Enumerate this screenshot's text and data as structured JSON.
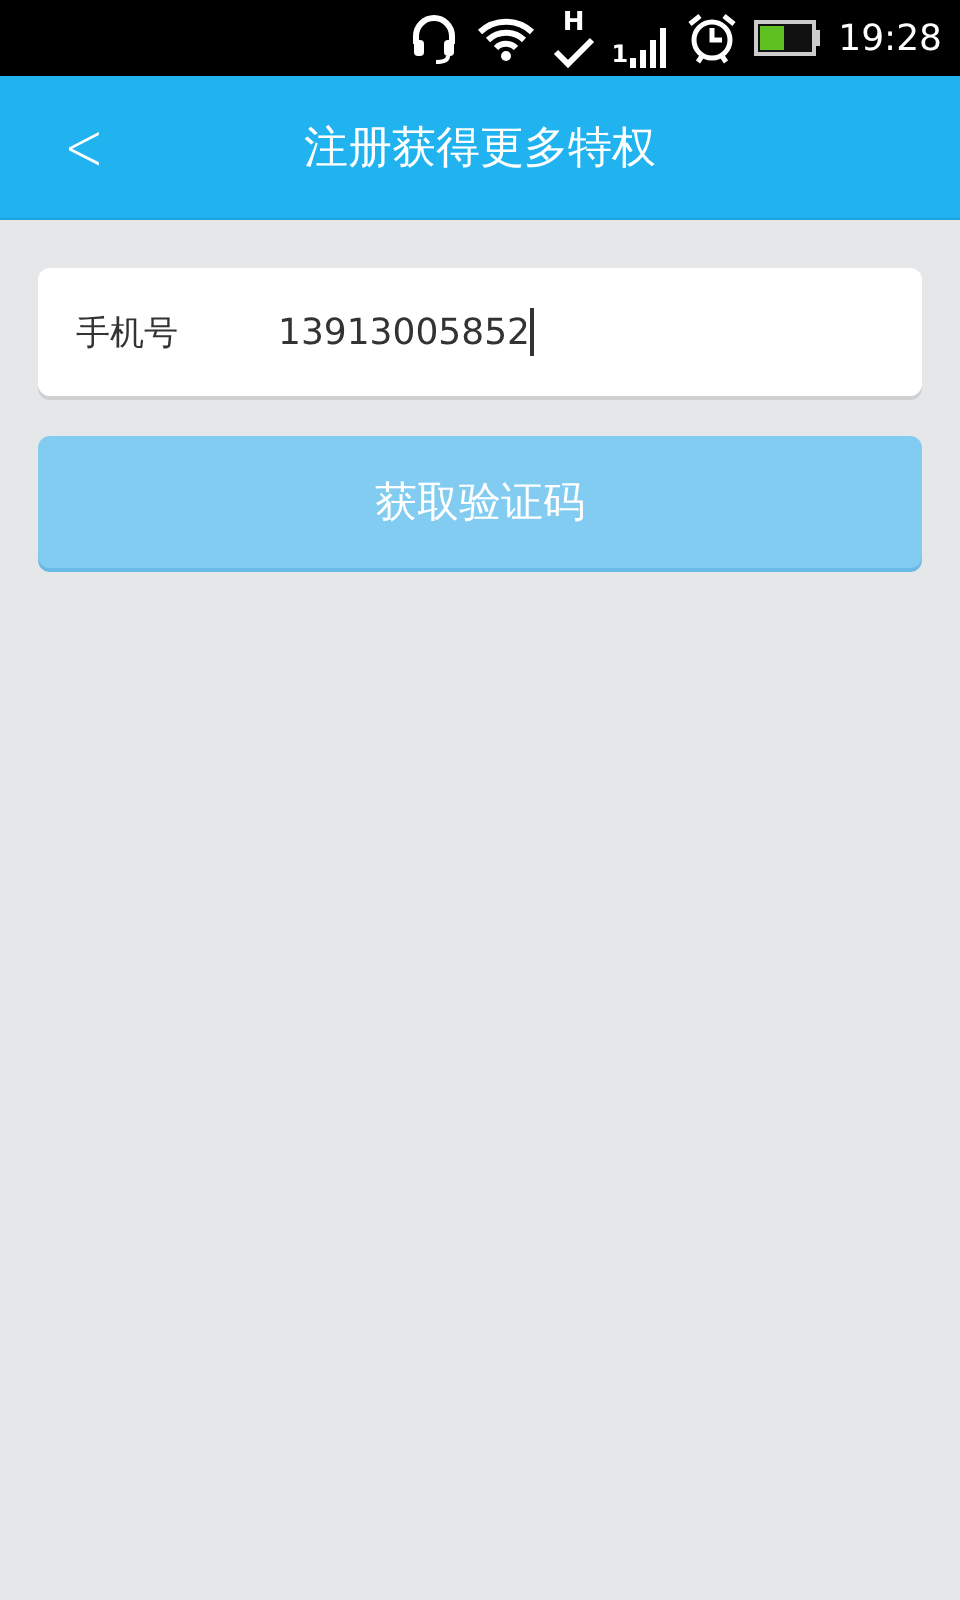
{
  "status_bar": {
    "network": "H",
    "sim": "1",
    "time": "19:28"
  },
  "header": {
    "back": "<",
    "title": "注册获得更多特权"
  },
  "phone_field": {
    "label": "手机号",
    "value": "13913005852",
    "focused": true
  },
  "button": {
    "label": "获取验证码",
    "disabled": true
  }
}
